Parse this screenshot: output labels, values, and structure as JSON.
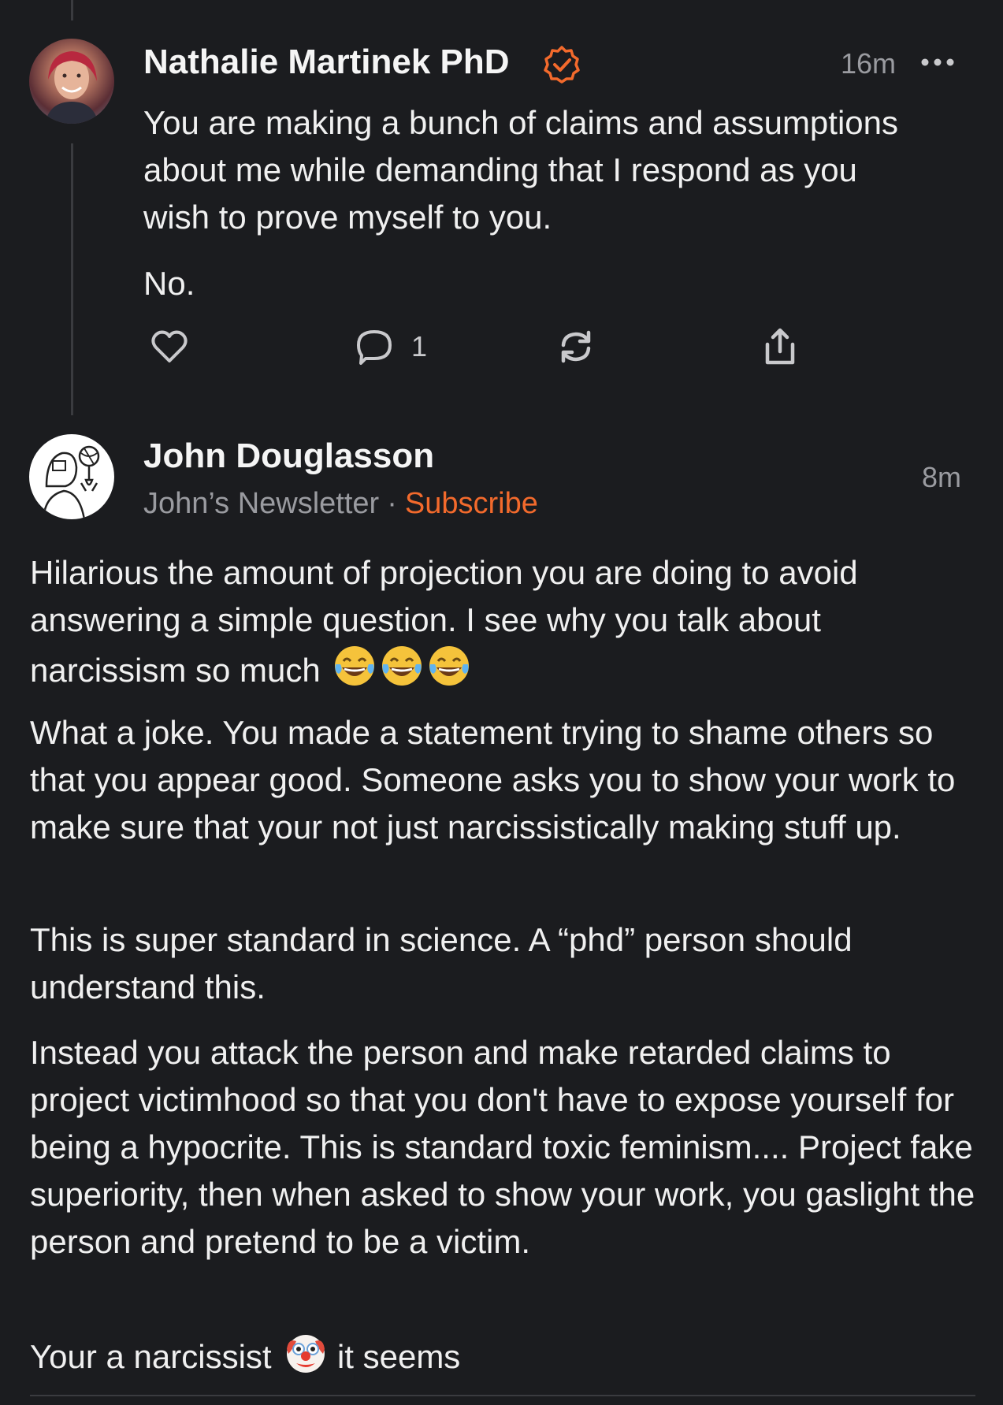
{
  "comment1": {
    "author": "Nathalie Martinek PhD",
    "time": "16m",
    "paragraphs": [
      "You are making a bunch of claims and assumptions about me while demanding that I respond as you wish to prove myself to you.",
      "No."
    ],
    "actions": {
      "comment_count": "1"
    }
  },
  "comment2": {
    "author": "John Douglasson",
    "newsletter": "John’s Newsletter",
    "separator": "·",
    "subscribe_label": "Subscribe",
    "time": "8m",
    "paragraphs": [
      "Hilarious the amount of projection you are doing to avoid answering a simple question. I see why you talk about narcissism so much",
      "What a joke. You made a statement trying to shame others so that you appear good. Someone asks you to show your work to make sure that your not just narcissistically making stuff up.",
      "This is super standard in science. A “phd” person should understand this.",
      "Instead you attack the person and make retarded claims to project victimhood so that you don't have to expose yourself for being a hypocrite. This is standard toxic feminism.... Project fake superiority, then when asked to show your work, you gaslight the person and pretend to be a victim.",
      "Your a narcissist",
      "it seems"
    ]
  },
  "colors": {
    "background": "#1b1c1f",
    "accent": "#f36a2c",
    "muted_text": "#9a9ba0"
  },
  "icons": [
    "verified-badge-icon",
    "more-icon",
    "heart-icon",
    "comment-icon",
    "restack-icon",
    "share-icon",
    "laughing-emoji-icon",
    "clown-emoji-icon"
  ]
}
